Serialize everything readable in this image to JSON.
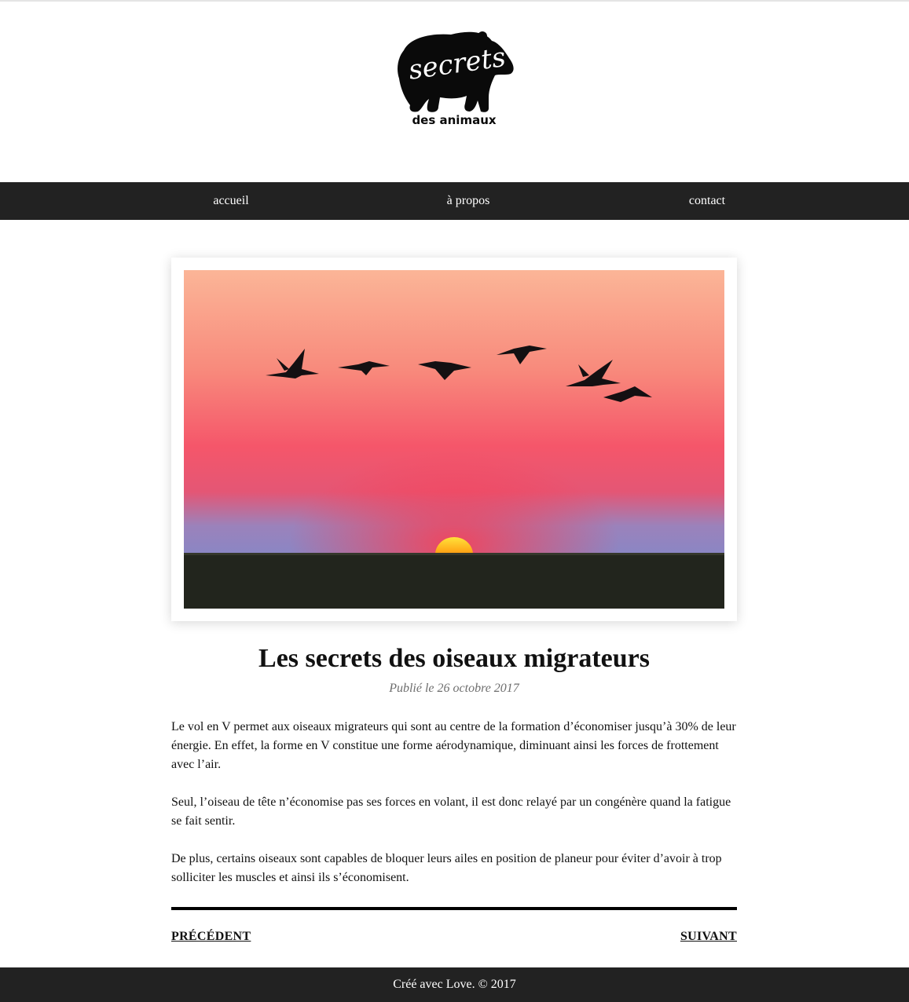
{
  "brand": {
    "logo_word": "secrets",
    "logo_subtitle": "des animaux"
  },
  "nav": {
    "items": [
      {
        "label": "accueil"
      },
      {
        "label": "à propos"
      },
      {
        "label": "contact"
      }
    ]
  },
  "article": {
    "title": "Les secrets des oiseaux migrateurs",
    "date": "Publié le 26 octobre 2017",
    "paragraphs": [
      "Le vol en V permet aux oiseaux migrateurs qui sont au centre de la formation d’économiser jusqu’à 30% de leur énergie. En effet, la forme en V constitue une forme aérodynamique, diminuant ainsi les forces de frottement avec l’air.",
      "Seul, l’oiseau de tête n’économise pas ses forces en volant, il est donc relayé par un congénère quand la fatigue se fait sentir.",
      "De plus, certains oiseaux sont capables de bloquer leurs ailes en position de planeur pour éviter d’avoir à trop solliciter les muscles et ainsi ils s’économisent."
    ]
  },
  "pager": {
    "prev_label": "PRÉCÉDENT",
    "next_label": "SUIVANT"
  },
  "footer": {
    "text": "Créé avec Love. © 2017"
  },
  "colors": {
    "nav_bg": "#222222",
    "footer_bg": "#222222",
    "sky_top": "#fbb597",
    "sky_mid": "#f5566a",
    "sky_horizon": "#8a86c4",
    "ground": "#22251d",
    "sun": "#ffd21e"
  }
}
